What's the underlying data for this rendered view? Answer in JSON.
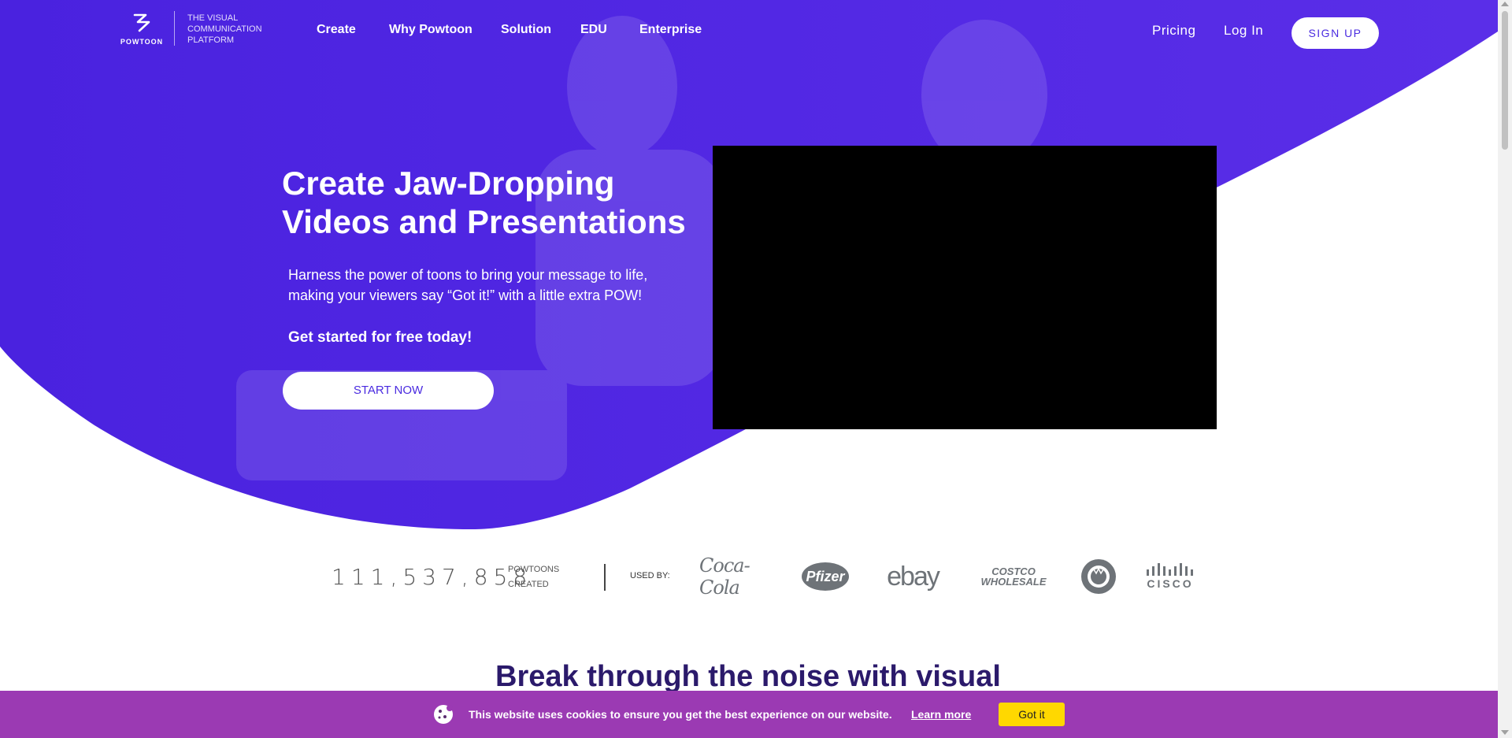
{
  "colors": {
    "hero": "#4b22e0",
    "accent": "#4a2be0",
    "cookie_bar": "#9b3ab3",
    "cookie_button": "#ffd800",
    "section_title": "#2b1a6b"
  },
  "brand": {
    "logo_text": "POWTOON",
    "tagline": "THE VISUAL COMMUNICATION PLATFORM"
  },
  "nav": {
    "links": [
      "Create",
      "Why Powtoon",
      "Solution",
      "EDU",
      "Enterprise"
    ],
    "pricing": "Pricing",
    "login": "Log In",
    "signup": "SIGN UP"
  },
  "hero": {
    "headline": "Create Jaw-Dropping Videos and Presentations",
    "subtext": "Harness the power of toons to bring your message to life, making your viewers say “Got it!” with a little extra POW!",
    "cta_text": "Get started for free today!",
    "button": "START NOW"
  },
  "stats": {
    "count": "111,537,858",
    "count_label": "POWTOONS CREATED",
    "used_by": "USED BY:",
    "brands": [
      "Coca-Cola",
      "Pfizer",
      "ebay",
      "COSTCO WHOLESALE",
      "Starbucks",
      "CISCO"
    ]
  },
  "section": {
    "title": "Break through the noise with visual communications"
  },
  "cookie": {
    "message": "This website uses cookies to ensure you get the best experience on our website.",
    "link": "Learn more",
    "button": "Got it"
  }
}
